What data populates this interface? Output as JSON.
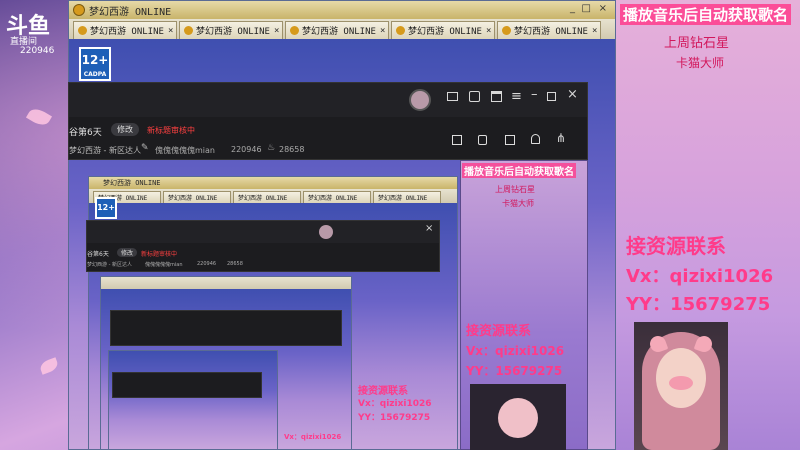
{
  "douyu": {
    "logo": "斗鱼",
    "sub": "直播间",
    "room_id": "220946"
  },
  "game": {
    "title": "梦幻西游 ONLINE",
    "tabs": [
      "梦幻西游 ONLINE",
      "梦幻西游 ONLINE",
      "梦幻西游 ONLINE",
      "梦幻西游 ONLINE",
      "梦幻西游 ONLINE"
    ],
    "tab_close": "×",
    "age_rating": "12+",
    "age_caption": "CADPA",
    "win_min": "_",
    "win_max": "□",
    "win_close": "×"
  },
  "streamer_panel": {
    "title_line": "谷第6天",
    "edit_label": "修改",
    "category_line": "梦幻西游 - 新区达人",
    "nickname": "傀傀傀傀傀mian",
    "room_id": "220946",
    "heat": "28658",
    "status": "新标题审核中"
  },
  "overlay": {
    "headline": "播放音乐后自动获取歌名",
    "week_star": "上周钻石星",
    "cat_master": "卡猫大师",
    "contact_title": "接资源联系",
    "vx": "Vx：qizixi1026",
    "yy": "YY：15679275"
  },
  "colors": {
    "accent": "#ff3b8a",
    "panel_bg": "#1c1c1f",
    "age_blue": "#1e5fb7"
  }
}
